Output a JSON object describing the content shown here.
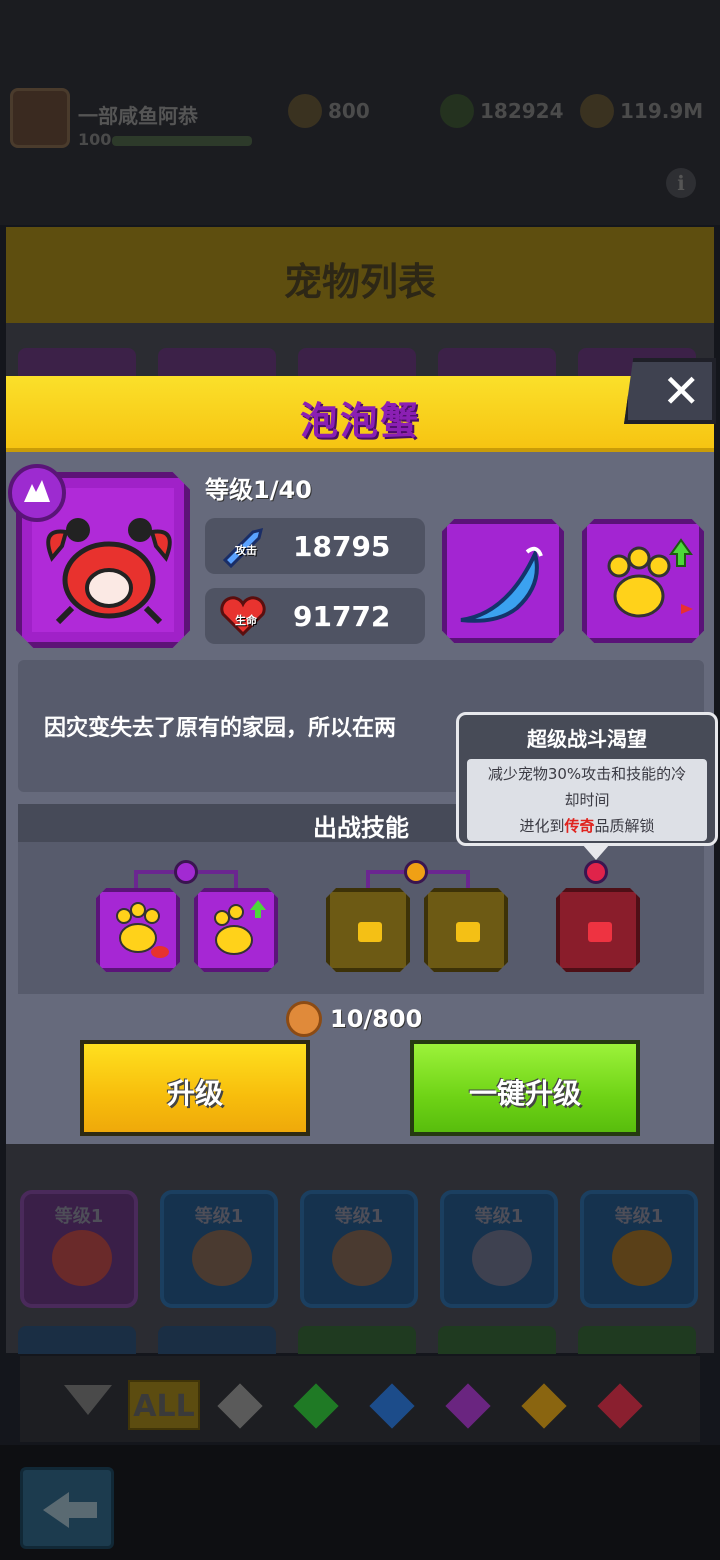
{
  "player": {
    "name": "一部咸鱼阿恭",
    "level": "100"
  },
  "resources": {
    "gems": "800",
    "energy": "182924",
    "gold": "119.9M"
  },
  "info_icon": "ℹ",
  "list_title": "宠物列表",
  "list_cards": [
    {
      "level": "等级1",
      "color": "purple"
    },
    {
      "level": "等级1",
      "color": "blue"
    },
    {
      "level": "等级1",
      "color": "blue"
    },
    {
      "level": "等级1",
      "color": "blue"
    },
    {
      "level": "等级1",
      "color": "blue"
    }
  ],
  "filter": {
    "all_label": "ALL",
    "gems": [
      "#5a5a5a",
      "#1f7a25",
      "#1c4c8a",
      "#6a2580",
      "#8a6510",
      "#8a1f2f"
    ]
  },
  "modal": {
    "title": "泡泡蟹",
    "close_label": "✕",
    "level_text": "等级1/40",
    "attack_tag": "攻击",
    "attack_value": "18795",
    "hp_tag": "生命",
    "hp_value": "91772",
    "description": "因灾变失去了原有的家园，所以在两",
    "battle_skills_title": "出战技能",
    "cost": "10/800",
    "upgrade_label": "升级",
    "onekey_label": "一键升级"
  },
  "tooltip": {
    "title": "超级战斗渴望",
    "line1": "减少宠物30%攻击和技能的冷",
    "line2": "却时间",
    "line3_pre": "进化到",
    "line3_highlight": "传奇",
    "line3_post": "品质解锁"
  },
  "colors": {
    "header_yellow": "#fbe02a",
    "title_purple": "#8b1fb3",
    "panel_gray": "#666a7c",
    "upgrade_yellow": "#f7bd0c",
    "onekey_green": "#6fd316",
    "legend_red": "#e0231e"
  },
  "icons": [
    "crab-icon",
    "sword-icon",
    "heart-icon",
    "water-wave-icon",
    "paw-up-icon",
    "paw-crab-icon",
    "lock-icon",
    "wolf-rank-icon",
    "back-arrow-icon",
    "coin-icon"
  ]
}
